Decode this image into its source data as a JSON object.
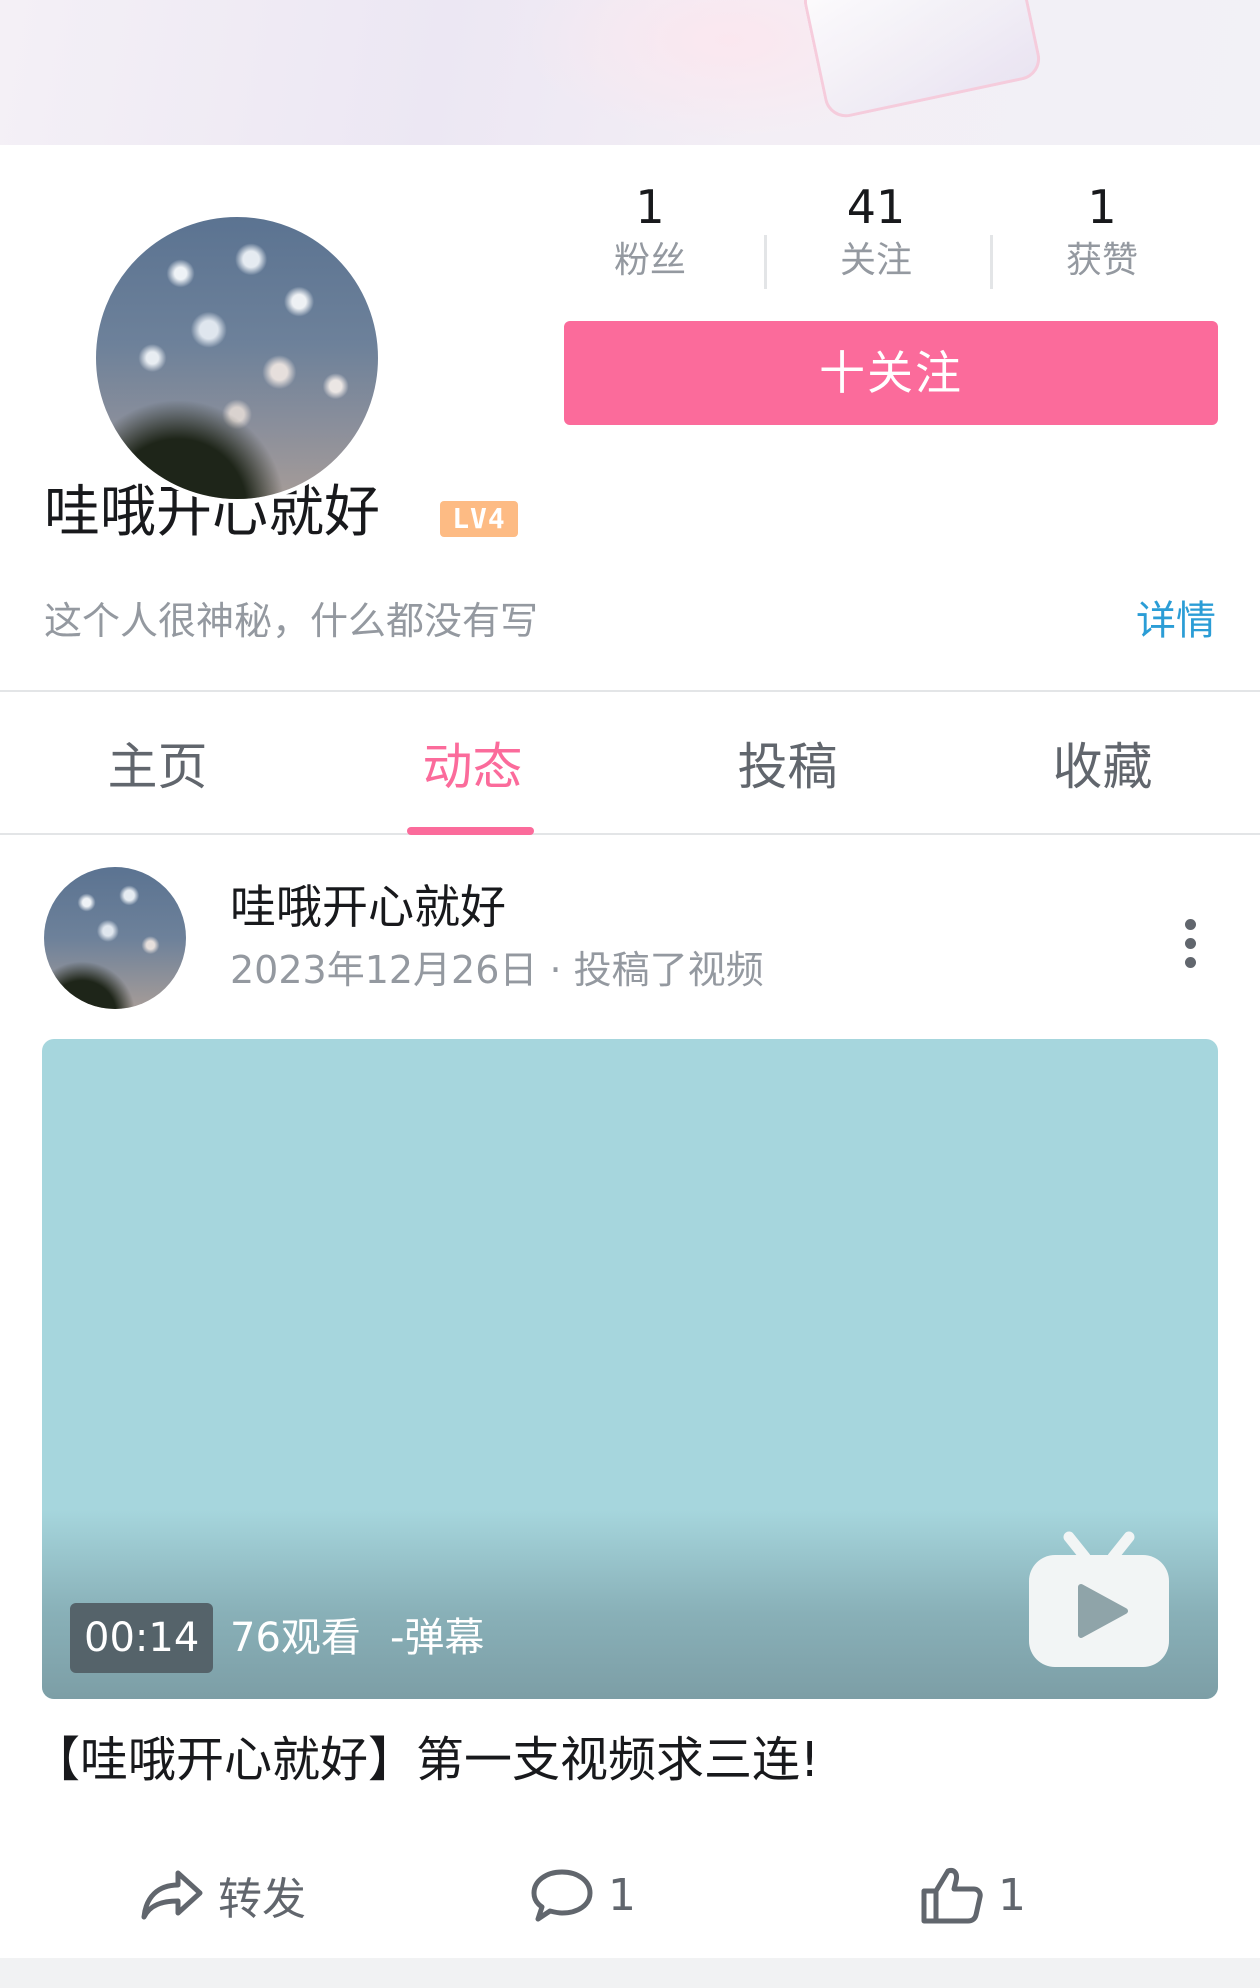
{
  "profile": {
    "stats": [
      {
        "value": "1",
        "label": "粉丝"
      },
      {
        "value": "41",
        "label": "关注"
      },
      {
        "value": "1",
        "label": "获赞"
      }
    ],
    "follow_button": "十关注",
    "username": "哇哦开心就好",
    "level_badge": "LV4",
    "bio": "这个人很神秘，什么都没有写",
    "detail_link": "详情"
  },
  "tabs": [
    {
      "label": "主页",
      "active": false
    },
    {
      "label": "动态",
      "active": true
    },
    {
      "label": "投稿",
      "active": false
    },
    {
      "label": "收藏",
      "active": false
    }
  ],
  "post": {
    "author": "哇哦开心就好",
    "meta": "2023年12月26日 · 投稿了视频",
    "video": {
      "duration": "00:14",
      "views": "76观看",
      "danmaku": "-弹幕",
      "thumbnail_color": "#a6d6dd"
    },
    "title": "【哇哦开心就好】第一支视频求三连!",
    "actions": {
      "share_label": "转发",
      "comment_count": "1",
      "like_count": "1"
    }
  },
  "colors": {
    "accent_pink": "#fb6b9b",
    "link_blue": "#2b9dd6",
    "text_secondary": "#9499a0",
    "level_orange": "#fdbb84"
  }
}
